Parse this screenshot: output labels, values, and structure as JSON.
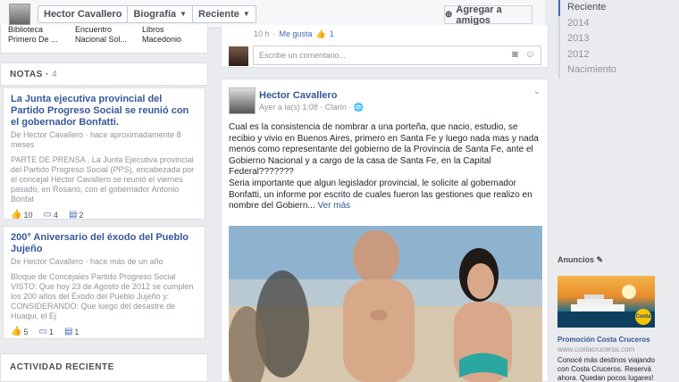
{
  "topbar": {
    "profile_name": "Hector Cavallero",
    "section": "Biografía",
    "filter": "Reciente",
    "add_friend": "Agregar a amigos"
  },
  "timeline_nav": [
    "Reciente",
    "2014",
    "2013",
    "2012",
    "Nacimiento"
  ],
  "strip": [
    {
      "line1": "Biblioteca",
      "line2": "Primero De ..."
    },
    {
      "line1": "Encuentro",
      "line2": "Nacional Sol..."
    },
    {
      "line1": "Libros",
      "line2": "Macedonio"
    }
  ],
  "notes": {
    "title": "NOTAS",
    "count": "4",
    "items": [
      {
        "title": "La Junta ejecutiva provincial del Partido Progreso Social se reunió con el gobernador Bonfatti.",
        "meta": "De Hector Cavallero · hace aproximadamente 8 meses",
        "body": "PARTE DE PRENSA . La Junta Ejecutiva provincial del Partido Progreso Social (PPS), encabezada por el concejal Héctor Cavallero se reunió el viernes pasado, en Rosario, con el gobernador Antonio Bonfat",
        "likes": "10",
        "comments": "4",
        "shares": "2"
      },
      {
        "title": "200° Aniversario del éxodo del Pueblo Jujeño",
        "meta": "De Hector Cavallero · hace más de un año",
        "body": "Bloque de Concejales Partido Progreso Social VISTO: Que hoy 23 de Agosto de 2012 se cumplen los 200 años del Éxodo del Pueblo Jujeño y: CONSIDERANDO: Que luego del desastre de Huaqui, el Ej",
        "likes": "5",
        "comments": "1",
        "shares": "1"
      }
    ]
  },
  "activity_title": "ACTIVIDAD RECIENTE",
  "prev_post": {
    "time": "10 h",
    "like_link": "Me gusta",
    "likes": "1",
    "comment_placeholder": "Escribe un comentario..."
  },
  "post": {
    "author": "Hector Cavallero",
    "meta": "Ayer a la(s) 1:08 · Clarín ·",
    "paragraph1": "Cual es la consistencia de nombrar a una porteña, que nacio, estudio, se recibio y vivio en Buenos Aires, primero en Santa Fe y luego nada mas y nada menos como representante del gobierno de la Provincia de Santa Fe, ante el Gobierno Nacional y a cargo de la casa de Santa Fe, en la Capital Federal???????",
    "paragraph2": "Seria importante que algun legislador provincial, le solicite al gobernador Bonfatti, un informe por escrito de cuales fueron las gestiones que realizo en nombre del Gobiern...",
    "see_more": "Ver más"
  },
  "ads": {
    "title": "Anuncios",
    "ad_title": "Promoción Costa Cruceros",
    "ad_url": "www.costacruceros.com",
    "ad_text": "Conocé más destinos viajando con Costa Cruceros. Reservá ahora. Quedan pocos lugares!",
    "brand": "Costa"
  }
}
